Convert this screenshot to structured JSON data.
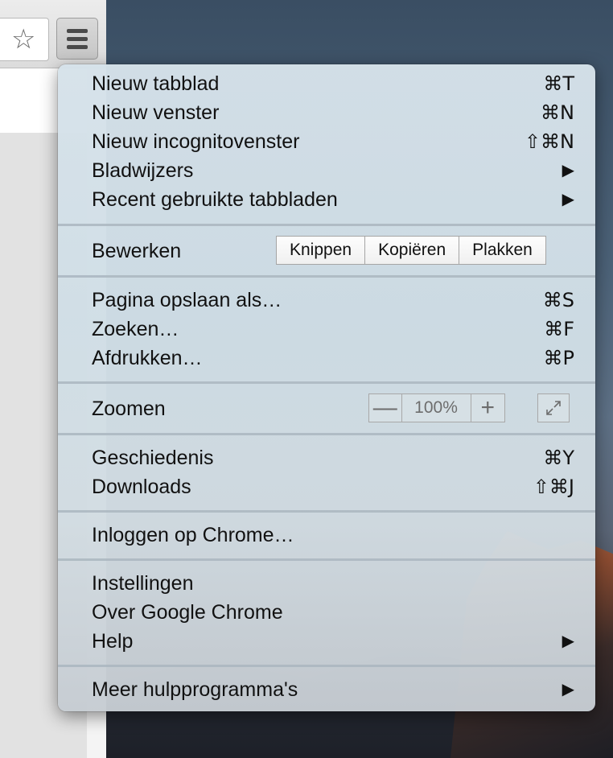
{
  "menu": {
    "group1": [
      {
        "label": "Nieuw tabblad",
        "shortcut": "⌘T"
      },
      {
        "label": "Nieuw venster",
        "shortcut": "⌘N"
      },
      {
        "label": "Nieuw incognitovenster",
        "shortcut": "⇧⌘N"
      },
      {
        "label": "Bladwijzers",
        "arrow": "▶"
      },
      {
        "label": "Recent gebruikte tabbladen",
        "arrow": "▶"
      }
    ],
    "edit": {
      "label": "Bewerken",
      "cut": "Knippen",
      "copy": "Kopiëren",
      "paste": "Plakken"
    },
    "group2": [
      {
        "label": "Pagina opslaan als…",
        "shortcut": "⌘S"
      },
      {
        "label": "Zoeken…",
        "shortcut": "⌘F"
      },
      {
        "label": "Afdrukken…",
        "shortcut": "⌘P"
      }
    ],
    "zoom": {
      "label": "Zoomen",
      "minus": "—",
      "value": "100%",
      "plus": "+"
    },
    "group3": [
      {
        "label": "Geschiedenis",
        "shortcut": "⌘Y"
      },
      {
        "label": "Downloads",
        "shortcut": "⇧⌘J"
      }
    ],
    "signin": {
      "label": "Inloggen op Chrome…"
    },
    "group4": [
      {
        "label": "Instellingen"
      },
      {
        "label": "Over Google Chrome"
      },
      {
        "label": "Help",
        "arrow": "▶"
      }
    ],
    "more_tools": {
      "label": "Meer hulpprogramma's",
      "arrow": "▶"
    }
  },
  "icons": {
    "bookmark_star": "star-icon",
    "menu": "hamburger-menu-icon",
    "fullscreen": "fullscreen-icon"
  }
}
